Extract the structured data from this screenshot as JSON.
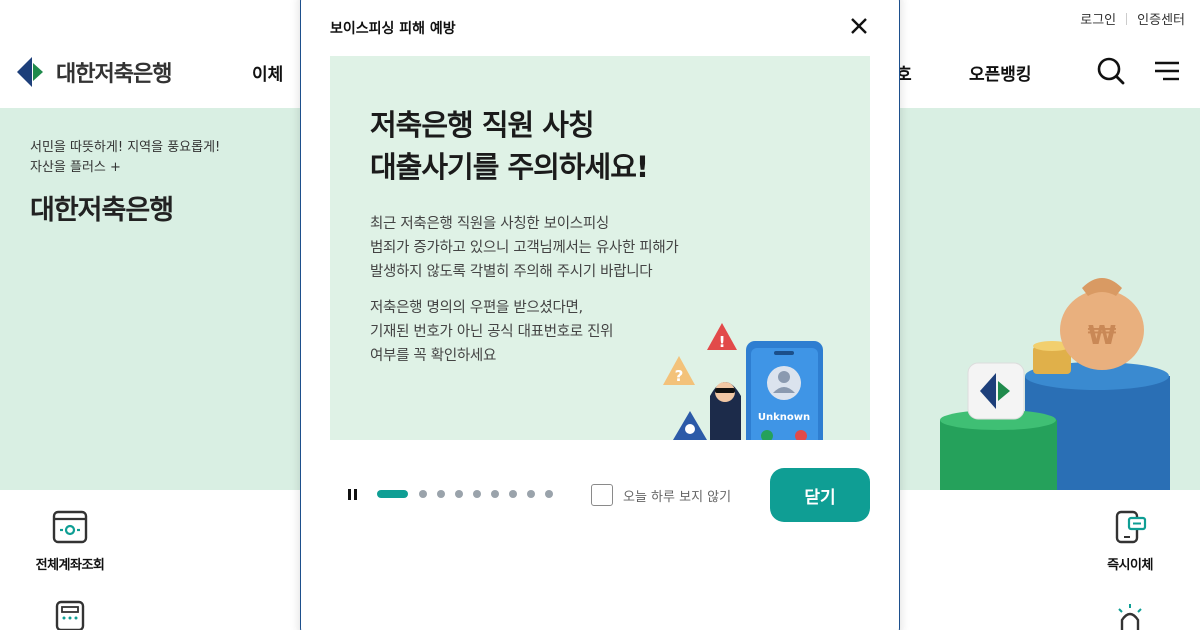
{
  "util": {
    "login": "로그인",
    "cert_center": "인증센터"
  },
  "header": {
    "logo_text": "대한저축은행",
    "nav": {
      "transfer": "이체",
      "partial": "호",
      "open_banking": "오픈뱅킹"
    }
  },
  "hero": {
    "subtitle_line1": "서민을 따뜻하게! 지역을 풍요롭게!",
    "subtitle_line2": "자산을 플러스 +",
    "title": "대한저축은행"
  },
  "quick_menu": {
    "all_account": "전체계좌조회",
    "instant_transfer": "즉시이체"
  },
  "modal": {
    "title": "보이스피싱 피해 예방",
    "slide": {
      "headline_1": "저축은행 직원 사칭",
      "headline_2": "대출사기를 주의하세요!",
      "para1_line1": "최근 저축은행 직원을 사칭한 보이스피싱",
      "para1_line2": "범죄가 증가하고 있으니 고객님께서는 유사한 피해가",
      "para1_line3": "발생하지 않도록 각별히 주의해 주시기 바랍니다",
      "para2_line1": "저축은행 명의의 우편을 받으셨다면,",
      "para2_line2": "기재된 번호가 아닌 공식 대표번호로 진위",
      "para2_line3": "여부를 꼭 확인하세요",
      "phone_caller": "Unknown"
    },
    "slider": {
      "total": 9,
      "current": 1
    },
    "dont_show_today": "오늘 하루 보지 않기",
    "close_button": "닫기"
  },
  "colors": {
    "accent": "#0f9e94",
    "hero_bg": "#d9efe3",
    "slide_bg": "#dff2e6",
    "modal_border": "#1d4f8c"
  }
}
